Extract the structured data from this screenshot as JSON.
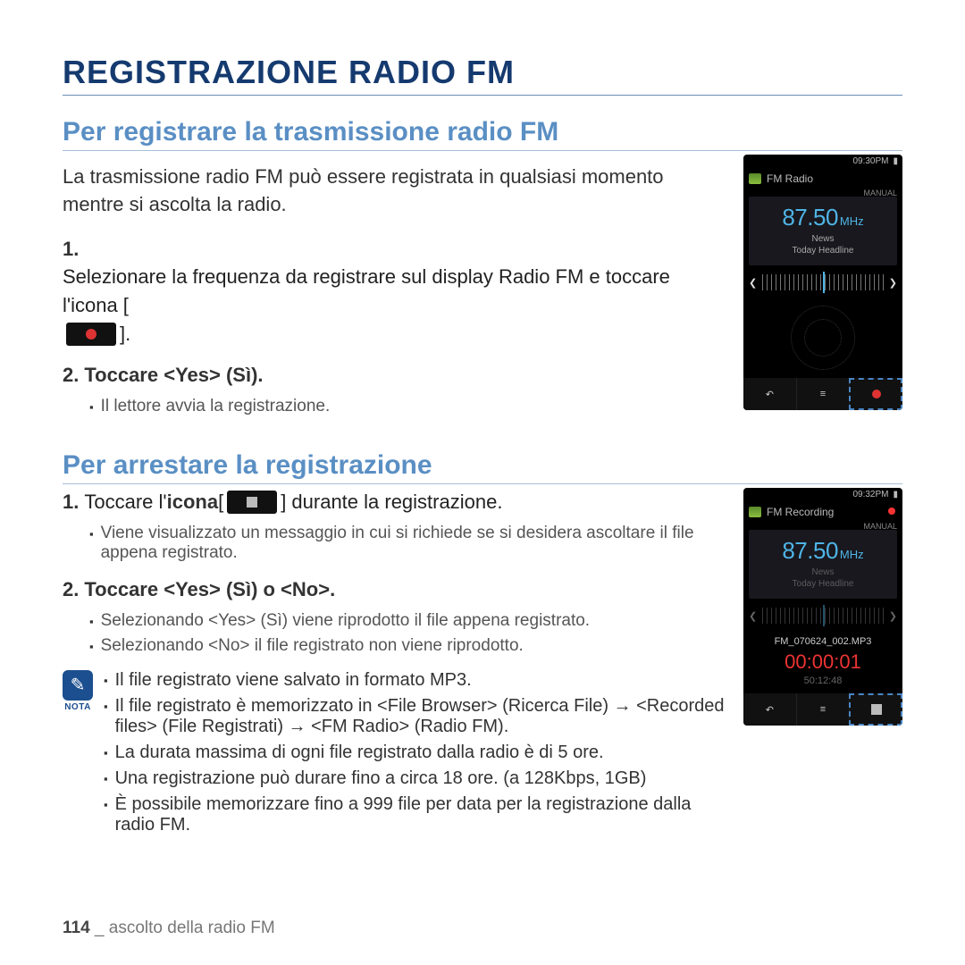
{
  "title": "REGISTRAZIONE RADIO FM",
  "section1": {
    "heading": "Per registrare la trasmissione radio FM",
    "intro": "La trasmissione radio FM può essere registrata in qualsiasi momento mentre si ascolta la radio.",
    "step1_a": "Selezionare la frequenza da registrare sul display Radio FM e toccare l'icona [",
    "step1_b": "].",
    "step2": "Toccare <Yes> (Sì).",
    "sub1": "Il lettore avvia la registrazione."
  },
  "section2": {
    "heading": "Per arrestare la registrazione",
    "step1_a": "Toccare l'",
    "step1_b": "icona",
    "step1_c": " [",
    "step1_d": "] durante la registrazione.",
    "sub1": "Viene visualizzato un messaggio in cui si richiede se si desidera ascoltare il file appena registrato.",
    "step2": "Toccare <Yes> (Sì) o <No>.",
    "sub2": "Selezionando <Yes> (Sì) viene riprodotto il file appena registrato.",
    "sub3": "Selezionando <No> il file registrato non viene riprodotto."
  },
  "note_label": "NOTA",
  "notes": {
    "n1": "Il file registrato viene salvato in formato MP3.",
    "n2": "Il file registrato è memorizzato in <File Browser> (Ricerca File) → <Recorded files> (File Registrati)  → <FM Radio> (Radio FM).",
    "n3": "La durata massima di ogni file registrato dalla radio è di 5 ore.",
    "n4": "Una registrazione può durare fino a circa 18 ore. (a 128Kbps, 1GB)",
    "n5": "È possibile memorizzare fino a 999 file per data per la registrazione dalla radio FM."
  },
  "footer": {
    "page": "114",
    "sep": " _ ",
    "text": "ascolto della radio FM"
  },
  "device1": {
    "time": "09:30PM",
    "title": "FM Radio",
    "manual": "MANUAL",
    "freq": "87.50",
    "unit": "MHz",
    "sub1": "News",
    "sub2": "Today Headline"
  },
  "device2": {
    "time": "09:32PM",
    "title": "FM Recording",
    "manual": "MANUAL",
    "freq": "87.50",
    "unit": "MHz",
    "sub1": "News",
    "sub2": "Today Headline",
    "filename": "FM_070624_002.MP3",
    "elapsed": "00:00:01",
    "total": "50:12:48"
  }
}
